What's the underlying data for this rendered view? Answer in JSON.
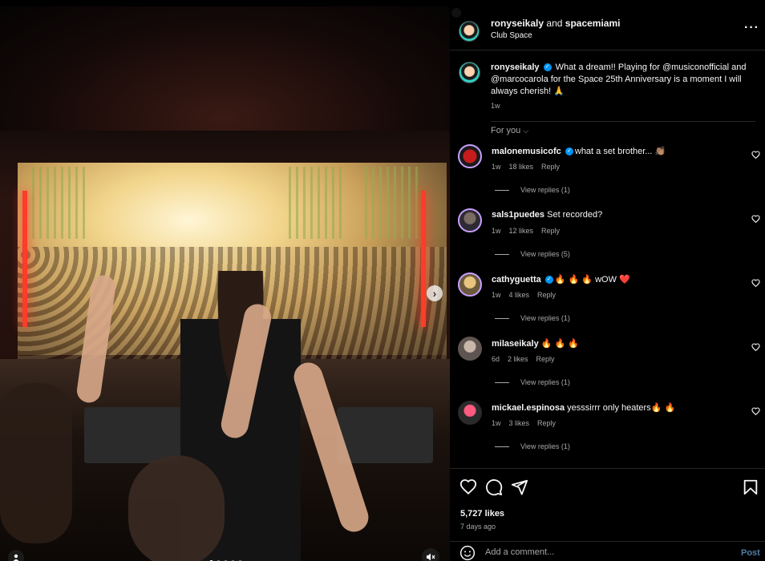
{
  "post": {
    "author": "ronyseikaly",
    "and_text": "and",
    "collaborator": "spacemiami",
    "location": "Club Space",
    "more_icon": "more-icon"
  },
  "caption": {
    "username": "ronyseikaly",
    "text": "What a dream!! Playing for @musiconofficial and @marcocarola for the Space 25th Anniversary is a moment I will always cherish! 🙏",
    "age": "1w"
  },
  "comments_header": {
    "label": "For you"
  },
  "comments": [
    {
      "username": "malonemusicofc",
      "verified": true,
      "text": "what a set brother... 👏🏽",
      "age": "1w",
      "likes": "18 likes",
      "reply": "Reply",
      "view_replies": "View replies (1)"
    },
    {
      "username": "sals1puedes",
      "verified": false,
      "text": "Set recorded?",
      "age": "1w",
      "likes": "12 likes",
      "reply": "Reply",
      "view_replies": "View replies (5)"
    },
    {
      "username": "cathyguetta",
      "verified": true,
      "text": "🔥 🔥 🔥 wOW ❤️",
      "age": "1w",
      "likes": "4 likes",
      "reply": "Reply",
      "view_replies": "View replies (1)"
    },
    {
      "username": "milaseikaly",
      "verified": false,
      "text": "🔥 🔥 🔥",
      "age": "6d",
      "likes": "2 likes",
      "reply": "Reply",
      "view_replies": "View replies (1)"
    },
    {
      "username": "mickael.espinosa",
      "verified": false,
      "text": "yesssirrr only heaters🔥 🔥",
      "age": "1w",
      "likes": "3 likes",
      "reply": "Reply",
      "view_replies": "View replies (1)"
    }
  ],
  "engagement": {
    "likes": "5,727 likes",
    "date": "7 days ago"
  },
  "add_comment": {
    "placeholder": "Add a comment...",
    "post_label": "Post"
  },
  "carousel": {
    "total": 5,
    "active": 0
  }
}
